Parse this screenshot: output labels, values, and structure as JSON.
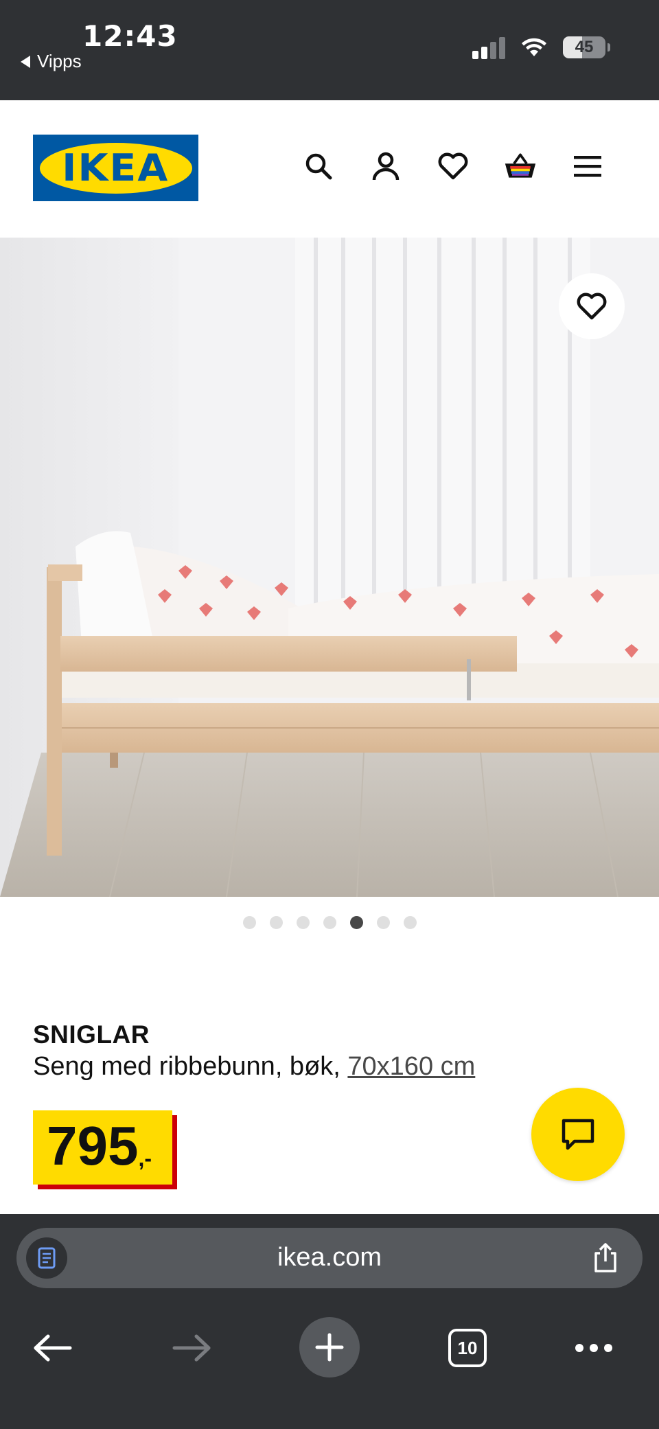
{
  "status_bar": {
    "time": "12:43",
    "back_label": "Vipps",
    "battery": "45"
  },
  "header": {
    "logo_text": "IKEA",
    "icons": [
      "search-icon",
      "account-icon",
      "heart-icon",
      "cart-icon",
      "menu-icon"
    ]
  },
  "gallery": {
    "image_description": "wooden child bed with heart-pattern bedding",
    "dot_count": 7,
    "active_index": 4
  },
  "product": {
    "name": "SNIGLAR",
    "description": "Seng med ribbebunn, bøk, ",
    "size_link": "70x160 cm",
    "price": "795",
    "price_suffix": ",-"
  },
  "browser": {
    "url": "ikea.com",
    "tab_count": "10"
  },
  "colors": {
    "ikea_blue": "#0058a3",
    "ikea_yellow": "#ffdb00",
    "price_shadow": "#cc0008",
    "browser_chrome": "#2f3134"
  }
}
